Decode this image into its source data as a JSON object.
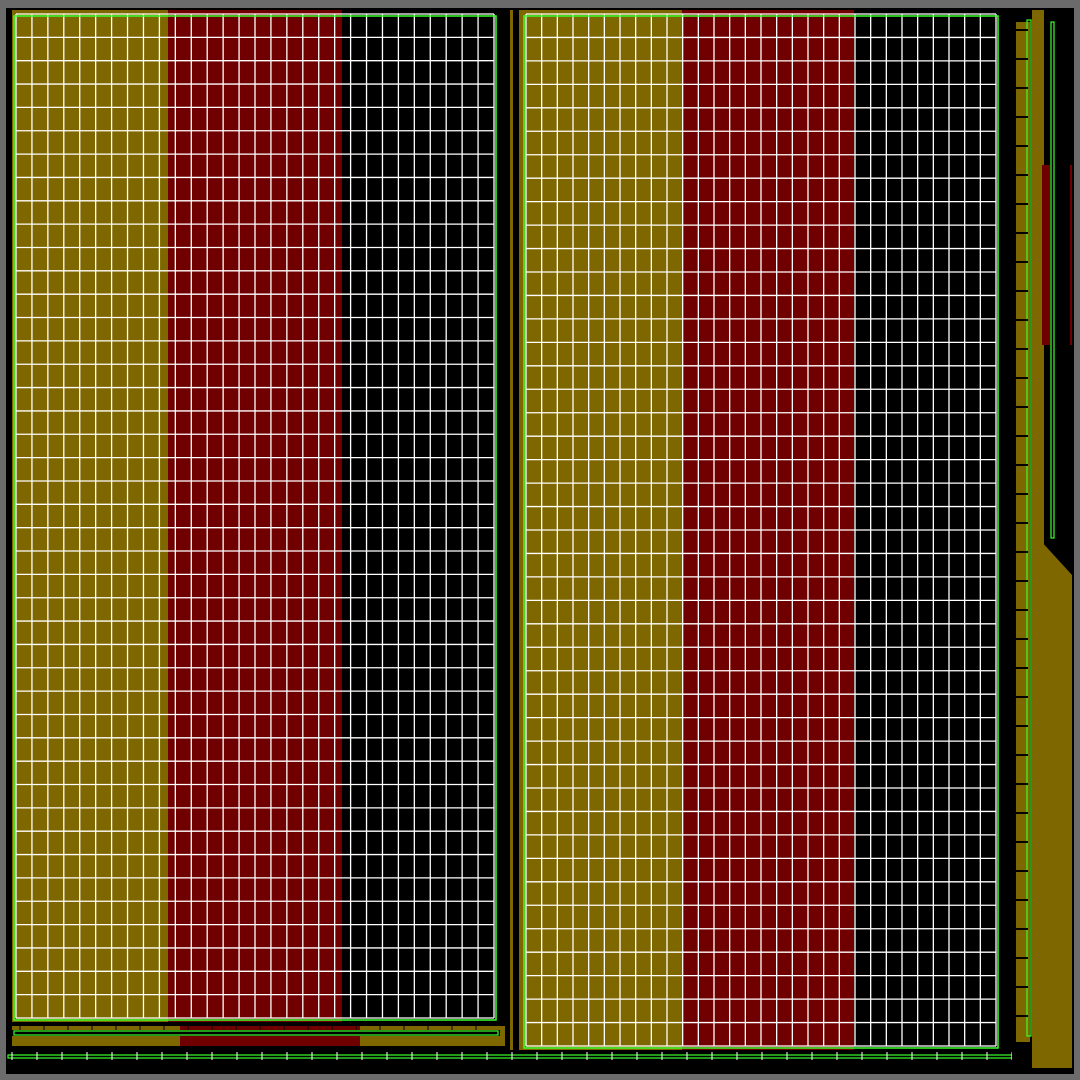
{
  "texture": {
    "palette": {
      "olive": "#7f6700",
      "dark_red": "#700000",
      "black": "#000000",
      "frame_gray": "#6b6b6b",
      "grid_white": "#ffffff",
      "outline_green": "#39ff2a"
    },
    "panels": [
      {
        "name": "left-panel",
        "stripes": [
          "olive",
          "dark_red",
          "black"
        ],
        "columns": 30
      },
      {
        "name": "right-panel",
        "stripes": [
          "olive",
          "dark_red",
          "black"
        ],
        "columns": 30
      }
    ],
    "side_strip": {
      "stripes": [
        "olive",
        "dark_red"
      ]
    },
    "bottom_strip": {
      "stripes": [
        "olive",
        "dark_red",
        "olive"
      ]
    }
  }
}
